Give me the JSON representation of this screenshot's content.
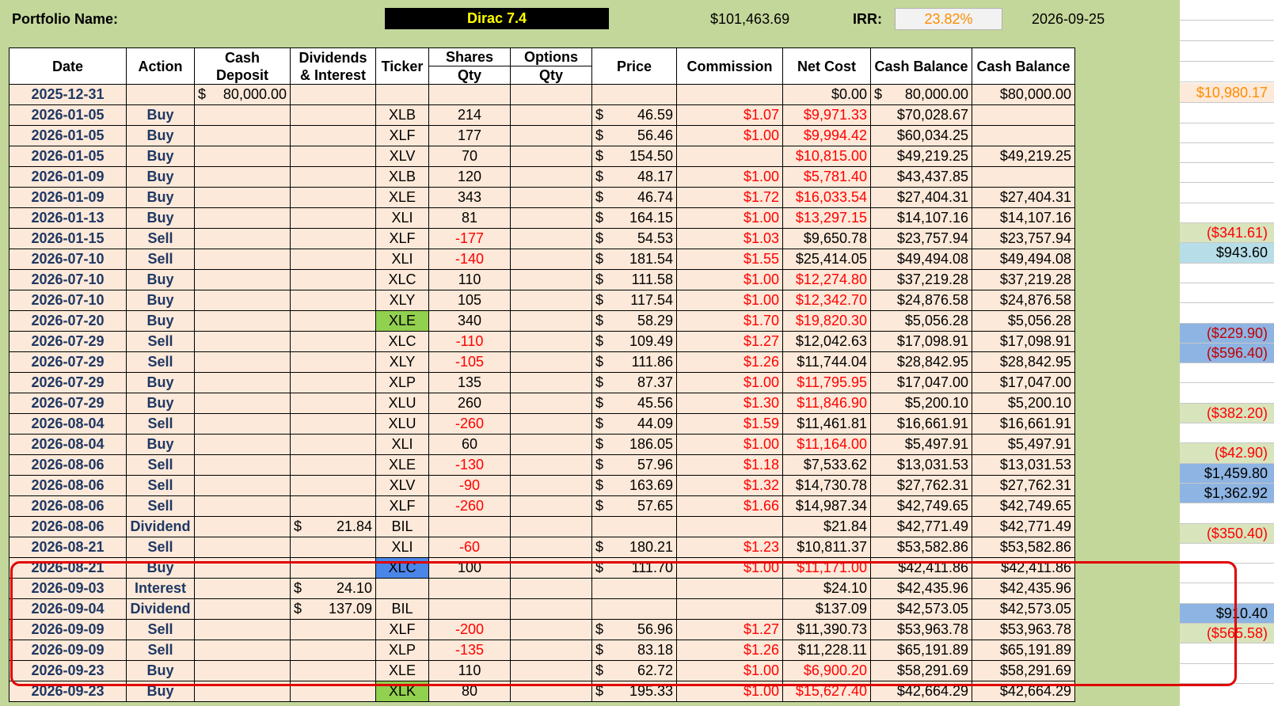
{
  "header": {
    "portfolio_label": "Portfolio Name:",
    "portfolio_name": "Dirac 7.4",
    "total_value": "$101,463.69",
    "irr_label": "IRR:",
    "irr_value": "23.82%",
    "report_date": "2026-09-25"
  },
  "columns": {
    "date": "Date",
    "action": "Action",
    "cash_deposit_1": "Cash",
    "cash_deposit_2": "Deposit",
    "dividends_1": "Dividends",
    "dividends_2": "& Interest",
    "ticker": "Ticker",
    "shares_1": "Shares",
    "shares_2": "Qty",
    "options_1": "Options",
    "options_2": "Qty",
    "price": "Price",
    "commission": "Commission",
    "net_cost": "Net Cost",
    "cash_balance_1": "Cash Balance",
    "cash_balance_2": "Cash Balance"
  },
  "rows": [
    {
      "date": "2025-12-31",
      "action": "",
      "deposit": "80,000.00",
      "div": "",
      "ticker": "",
      "shares": "",
      "options": "",
      "price": "",
      "commission": "",
      "net_cost": "$0.00",
      "cash_bal": "80,000.00",
      "cash_bal2": "$80,000.00",
      "pl": "$10,980.17",
      "pl_color": "#ff8c00",
      "pl_bg": "#fde9d9",
      "ticker_hl": ""
    },
    {
      "date": "2026-01-05",
      "action": "Buy",
      "deposit": "",
      "div": "",
      "ticker": "XLB",
      "shares": "214",
      "options": "",
      "price": "46.59",
      "commission": "$1.07",
      "net_cost": "$9,971.33",
      "cash_bal": "$70,028.67",
      "cash_bal2": "",
      "pl": "",
      "pl_color": "",
      "pl_bg": "",
      "ticker_hl": ""
    },
    {
      "date": "2026-01-05",
      "action": "Buy",
      "deposit": "",
      "div": "",
      "ticker": "XLF",
      "shares": "177",
      "options": "",
      "price": "56.46",
      "commission": "$1.00",
      "net_cost": "$9,994.42",
      "cash_bal": "$60,034.25",
      "cash_bal2": "",
      "pl": "",
      "pl_color": "",
      "pl_bg": "",
      "ticker_hl": ""
    },
    {
      "date": "2026-01-05",
      "action": "Buy",
      "deposit": "",
      "div": "",
      "ticker": "XLV",
      "shares": "70",
      "options": "",
      "price": "154.50",
      "commission": "",
      "net_cost": "$10,815.00",
      "cash_bal": "$49,219.25",
      "cash_bal2": "$49,219.25",
      "pl": "",
      "pl_color": "",
      "pl_bg": "",
      "ticker_hl": ""
    },
    {
      "date": "2026-01-09",
      "action": "Buy",
      "deposit": "",
      "div": "",
      "ticker": "XLB",
      "shares": "120",
      "options": "",
      "price": "48.17",
      "commission": "$1.00",
      "net_cost": "$5,781.40",
      "cash_bal": "$43,437.85",
      "cash_bal2": "",
      "pl": "",
      "pl_color": "",
      "pl_bg": "",
      "ticker_hl": ""
    },
    {
      "date": "2026-01-09",
      "action": "Buy",
      "deposit": "",
      "div": "",
      "ticker": "XLE",
      "shares": "343",
      "options": "",
      "price": "46.74",
      "commission": "$1.72",
      "net_cost": "$16,033.54",
      "cash_bal": "$27,404.31",
      "cash_bal2": "$27,404.31",
      "pl": "",
      "pl_color": "",
      "pl_bg": "",
      "ticker_hl": ""
    },
    {
      "date": "2026-01-13",
      "action": "Buy",
      "deposit": "",
      "div": "",
      "ticker": "XLI",
      "shares": "81",
      "options": "",
      "price": "164.15",
      "commission": "$1.00",
      "net_cost": "$13,297.15",
      "cash_bal": "$14,107.16",
      "cash_bal2": "$14,107.16",
      "pl": "",
      "pl_color": "",
      "pl_bg": "",
      "ticker_hl": ""
    },
    {
      "date": "2026-01-15",
      "action": "Sell",
      "deposit": "",
      "div": "",
      "ticker": "XLF",
      "shares": "-177",
      "options": "",
      "price": "54.53",
      "commission": "$1.03",
      "net_cost": "$9,650.78",
      "cash_bal": "$23,757.94",
      "cash_bal2": "$23,757.94",
      "pl": "($341.61)",
      "pl_color": "#ff0000",
      "pl_bg": "#d8e4bc",
      "ticker_hl": ""
    },
    {
      "date": "2026-07-10",
      "action": "Sell",
      "deposit": "",
      "div": "",
      "ticker": "XLI",
      "shares": "-140",
      "options": "",
      "price": "181.54",
      "commission": "$1.55",
      "net_cost": "$25,414.05",
      "cash_bal": "$49,494.08",
      "cash_bal2": "$49,494.08",
      "pl": "$943.60",
      "pl_color": "#000000",
      "pl_bg": "#b7dee8",
      "ticker_hl": ""
    },
    {
      "date": "2026-07-10",
      "action": "Buy",
      "deposit": "",
      "div": "",
      "ticker": "XLC",
      "shares": "110",
      "options": "",
      "price": "111.58",
      "commission": "$1.00",
      "net_cost": "$12,274.80",
      "cash_bal": "$37,219.28",
      "cash_bal2": "$37,219.28",
      "pl": "",
      "pl_color": "",
      "pl_bg": "",
      "ticker_hl": ""
    },
    {
      "date": "2026-07-10",
      "action": "Buy",
      "deposit": "",
      "div": "",
      "ticker": "XLY",
      "shares": "105",
      "options": "",
      "price": "117.54",
      "commission": "$1.00",
      "net_cost": "$12,342.70",
      "cash_bal": "$24,876.58",
      "cash_bal2": "$24,876.58",
      "pl": "",
      "pl_color": "",
      "pl_bg": "",
      "ticker_hl": ""
    },
    {
      "date": "2026-07-20",
      "action": "Buy",
      "deposit": "",
      "div": "",
      "ticker": "XLE",
      "shares": "340",
      "options": "",
      "price": "58.29",
      "commission": "$1.70",
      "net_cost": "$19,820.30",
      "cash_bal": "$5,056.28",
      "cash_bal2": "$5,056.28",
      "pl": "",
      "pl_color": "",
      "pl_bg": "",
      "ticker_hl": "green"
    },
    {
      "date": "2026-07-29",
      "action": "Sell",
      "deposit": "",
      "div": "",
      "ticker": "XLC",
      "shares": "-110",
      "options": "",
      "price": "109.49",
      "commission": "$1.27",
      "net_cost": "$12,042.63",
      "cash_bal": "$17,098.91",
      "cash_bal2": "$17,098.91",
      "pl": "($229.90)",
      "pl_color": "#c00000",
      "pl_bg": "#8db4e2",
      "ticker_hl": ""
    },
    {
      "date": "2026-07-29",
      "action": "Sell",
      "deposit": "",
      "div": "",
      "ticker": "XLY",
      "shares": "-105",
      "options": "",
      "price": "111.86",
      "commission": "$1.26",
      "net_cost": "$11,744.04",
      "cash_bal": "$28,842.95",
      "cash_bal2": "$28,842.95",
      "pl": "($596.40)",
      "pl_color": "#c00000",
      "pl_bg": "#8db4e2",
      "ticker_hl": ""
    },
    {
      "date": "2026-07-29",
      "action": "Buy",
      "deposit": "",
      "div": "",
      "ticker": "XLP",
      "shares": "135",
      "options": "",
      "price": "87.37",
      "commission": "$1.00",
      "net_cost": "$11,795.95",
      "cash_bal": "$17,047.00",
      "cash_bal2": "$17,047.00",
      "pl": "",
      "pl_color": "",
      "pl_bg": "",
      "ticker_hl": ""
    },
    {
      "date": "2026-07-29",
      "action": "Buy",
      "deposit": "",
      "div": "",
      "ticker": "XLU",
      "shares": "260",
      "options": "",
      "price": "45.56",
      "commission": "$1.30",
      "net_cost": "$11,846.90",
      "cash_bal": "$5,200.10",
      "cash_bal2": "$5,200.10",
      "pl": "",
      "pl_color": "",
      "pl_bg": "",
      "ticker_hl": ""
    },
    {
      "date": "2026-08-04",
      "action": "Sell",
      "deposit": "",
      "div": "",
      "ticker": "XLU",
      "shares": "-260",
      "options": "",
      "price": "44.09",
      "commission": "$1.59",
      "net_cost": "$11,461.81",
      "cash_bal": "$16,661.91",
      "cash_bal2": "$16,661.91",
      "pl": "($382.20)",
      "pl_color": "#ff0000",
      "pl_bg": "#d8e4bc",
      "ticker_hl": ""
    },
    {
      "date": "2026-08-04",
      "action": "Buy",
      "deposit": "",
      "div": "",
      "ticker": "XLI",
      "shares": "60",
      "options": "",
      "price": "186.05",
      "commission": "$1.00",
      "net_cost": "$11,164.00",
      "cash_bal": "$5,497.91",
      "cash_bal2": "$5,497.91",
      "pl": "",
      "pl_color": "",
      "pl_bg": "",
      "ticker_hl": ""
    },
    {
      "date": "2026-08-06",
      "action": "Sell",
      "deposit": "",
      "div": "",
      "ticker": "XLE",
      "shares": "-130",
      "options": "",
      "price": "57.96",
      "commission": "$1.18",
      "net_cost": "$7,533.62",
      "cash_bal": "$13,031.53",
      "cash_bal2": "$13,031.53",
      "pl": "($42.90)",
      "pl_color": "#ff0000",
      "pl_bg": "#d8e4bc",
      "ticker_hl": ""
    },
    {
      "date": "2026-08-06",
      "action": "Sell",
      "deposit": "",
      "div": "",
      "ticker": "XLV",
      "shares": "-90",
      "options": "",
      "price": "163.69",
      "commission": "$1.32",
      "net_cost": "$14,730.78",
      "cash_bal": "$27,762.31",
      "cash_bal2": "$27,762.31",
      "pl": "$1,459.80",
      "pl_color": "#000000",
      "pl_bg": "#8db4e2",
      "ticker_hl": ""
    },
    {
      "date": "2026-08-06",
      "action": "Sell",
      "deposit": "",
      "div": "",
      "ticker": "XLF",
      "shares": "-260",
      "options": "",
      "price": "57.65",
      "commission": "$1.66",
      "net_cost": "$14,987.34",
      "cash_bal": "$42,749.65",
      "cash_bal2": "$42,749.65",
      "pl": "$1,362.92",
      "pl_color": "#000000",
      "pl_bg": "#8db4e2",
      "ticker_hl": ""
    },
    {
      "date": "2026-08-06",
      "action": "Dividend",
      "deposit": "",
      "div": "21.84",
      "ticker": "BIL",
      "shares": "",
      "options": "",
      "price": "",
      "commission": "",
      "net_cost": "$21.84",
      "cash_bal": "$42,771.49",
      "cash_bal2": "$42,771.49",
      "pl": "",
      "pl_color": "",
      "pl_bg": "",
      "ticker_hl": ""
    },
    {
      "date": "2026-08-21",
      "action": "Sell",
      "deposit": "",
      "div": "",
      "ticker": "XLI",
      "shares": "-60",
      "options": "",
      "price": "180.21",
      "commission": "$1.23",
      "net_cost": "$10,811.37",
      "cash_bal": "$53,582.86",
      "cash_bal2": "$53,582.86",
      "pl": "($350.40)",
      "pl_color": "#ff0000",
      "pl_bg": "#d8e4bc",
      "ticker_hl": ""
    },
    {
      "date": "2026-08-21",
      "action": "Buy",
      "deposit": "",
      "div": "",
      "ticker": "XLC",
      "shares": "100",
      "options": "",
      "price": "111.70",
      "commission": "$1.00",
      "net_cost": "$11,171.00",
      "cash_bal": "$42,411.86",
      "cash_bal2": "$42,411.86",
      "pl": "",
      "pl_color": "",
      "pl_bg": "",
      "ticker_hl": "blue"
    },
    {
      "date": "2026-09-03",
      "action": "Interest",
      "deposit": "",
      "div": "24.10",
      "ticker": "",
      "shares": "",
      "options": "",
      "price": "",
      "commission": "",
      "net_cost": "$24.10",
      "cash_bal": "$42,435.96",
      "cash_bal2": "$42,435.96",
      "pl": "",
      "pl_color": "",
      "pl_bg": "",
      "ticker_hl": ""
    },
    {
      "date": "2026-09-04",
      "action": "Dividend",
      "deposit": "",
      "div": "137.09",
      "ticker": "BIL",
      "shares": "",
      "options": "",
      "price": "",
      "commission": "",
      "net_cost": "$137.09",
      "cash_bal": "$42,573.05",
      "cash_bal2": "$42,573.05",
      "pl": "",
      "pl_color": "",
      "pl_bg": "",
      "ticker_hl": ""
    },
    {
      "date": "2026-09-09",
      "action": "Sell",
      "deposit": "",
      "div": "",
      "ticker": "XLF",
      "shares": "-200",
      "options": "",
      "price": "56.96",
      "commission": "$1.27",
      "net_cost": "$11,390.73",
      "cash_bal": "$53,963.78",
      "cash_bal2": "$53,963.78",
      "pl": "$910.40",
      "pl_color": "#000000",
      "pl_bg": "#8db4e2",
      "ticker_hl": ""
    },
    {
      "date": "2026-09-09",
      "action": "Sell",
      "deposit": "",
      "div": "",
      "ticker": "XLP",
      "shares": "-135",
      "options": "",
      "price": "83.18",
      "commission": "$1.26",
      "net_cost": "$11,228.11",
      "cash_bal": "$65,191.89",
      "cash_bal2": "$65,191.89",
      "pl": "($565.58)",
      "pl_color": "#ff0000",
      "pl_bg": "#d8e4bc",
      "ticker_hl": ""
    },
    {
      "date": "2026-09-23",
      "action": "Buy",
      "deposit": "",
      "div": "",
      "ticker": "XLE",
      "shares": "110",
      "options": "",
      "price": "62.72",
      "commission": "$1.00",
      "net_cost": "$6,900.20",
      "cash_bal": "$58,291.69",
      "cash_bal2": "$58,291.69",
      "pl": "",
      "pl_color": "",
      "pl_bg": "",
      "ticker_hl": ""
    },
    {
      "date": "2026-09-23",
      "action": "Buy",
      "deposit": "",
      "div": "",
      "ticker": "XLK",
      "shares": "80",
      "options": "",
      "price": "195.33",
      "commission": "$1.00",
      "net_cost": "$15,627.40",
      "cash_bal": "$42,664.29",
      "cash_bal2": "$42,664.29",
      "pl": "",
      "pl_color": "",
      "pl_bg": "",
      "ticker_hl": "green"
    }
  ],
  "currency_symbol": "$",
  "colors": {
    "sheet_background": "#c4d79b",
    "row_fill": "#fde9d9",
    "negative_text": "#ff0000",
    "highlight_border": "#e00000"
  }
}
